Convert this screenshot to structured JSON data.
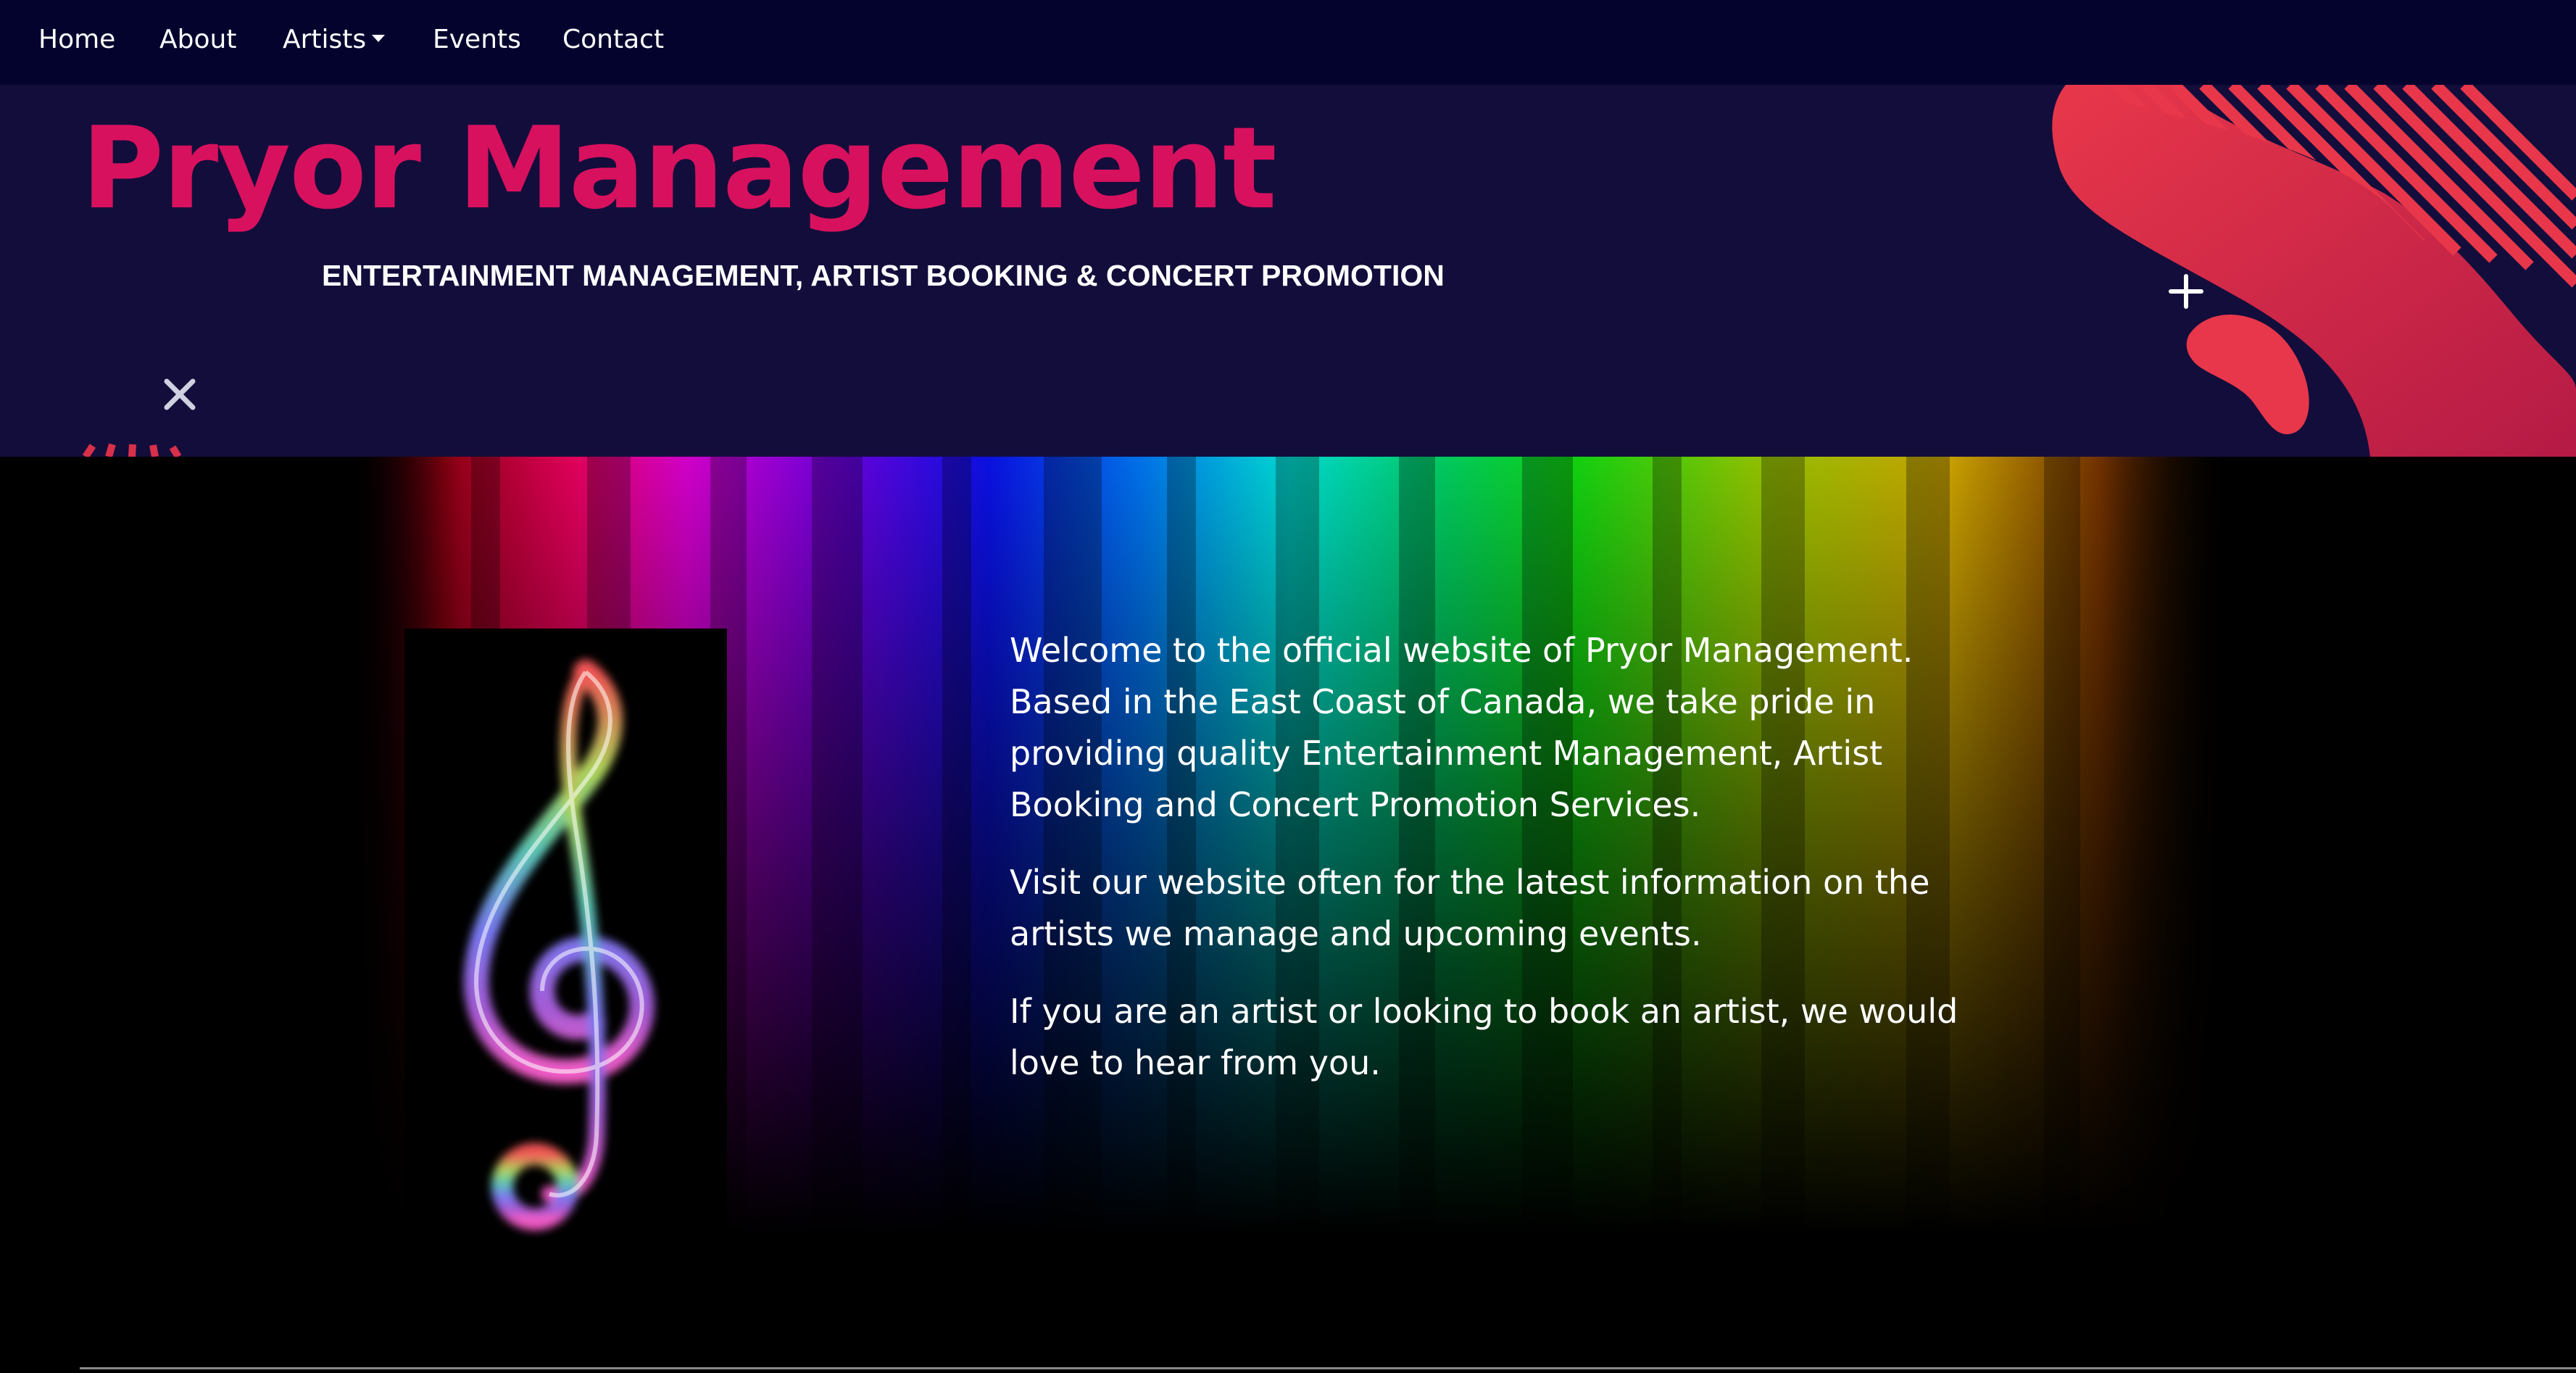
{
  "nav": {
    "items": [
      {
        "label": "Home"
      },
      {
        "label": "About"
      },
      {
        "label": "Artists"
      },
      {
        "label": "Events"
      },
      {
        "label": "Contact"
      }
    ]
  },
  "header": {
    "title": "Pryor Management",
    "subtitle": "ENTERTAINMENT MANAGEMENT, ARTIST BOOKING & CONCERT PROMOTION"
  },
  "main": {
    "paragraphs": [
      "Welcome to the official website of Pryor Management. Based in the East Coast of Canada, we take pride in providing quality Entertainment Management, Artist Booking and Concert Promotion Services.",
      "Visit our website often for the latest information on the artists we manage and upcoming events.",
      "If you are an artist or looking to book an artist, we would love to hear from you."
    ]
  },
  "colors": {
    "nav_bg": "#03032e",
    "header_bg": "#130d3b",
    "brand": "#d8115e",
    "text": "#ffffff"
  },
  "icons": [
    "chevron-down-icon",
    "close-icon",
    "plus-icon",
    "treble-clef-icon"
  ]
}
